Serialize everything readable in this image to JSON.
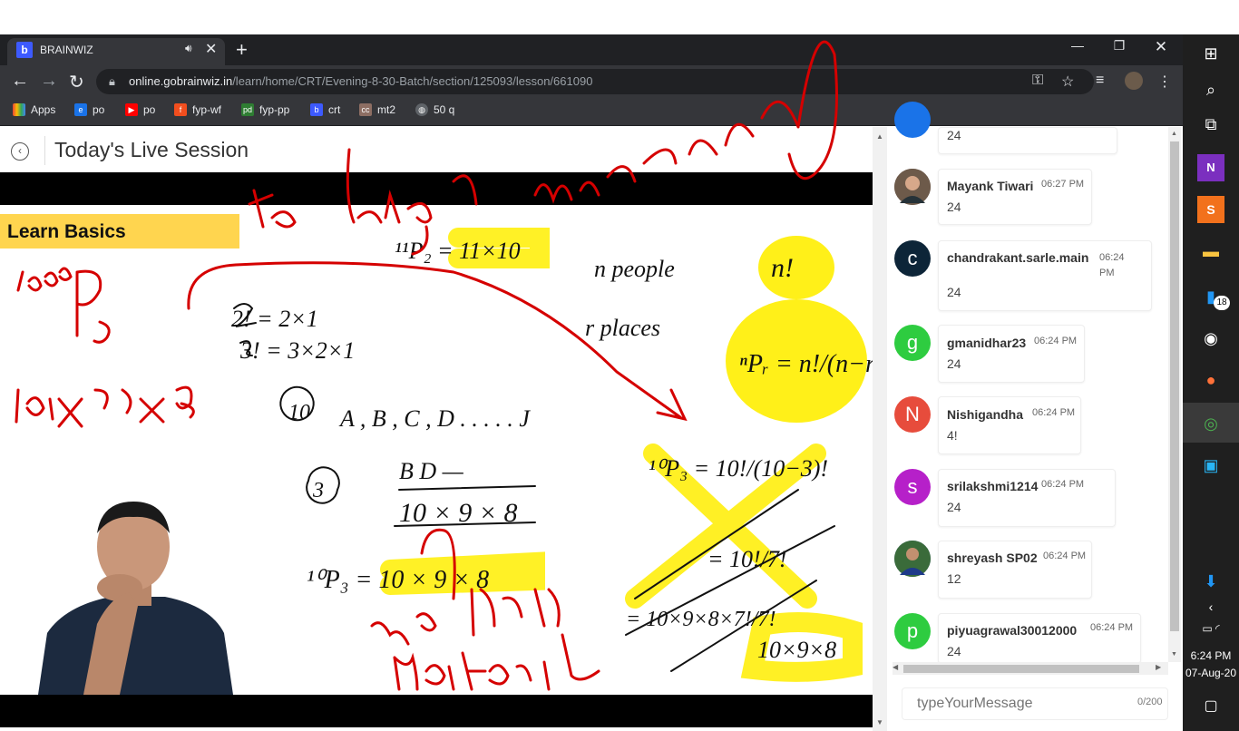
{
  "browser": {
    "tab_title": "BRAINWIZ",
    "favicon": "b",
    "tab_audio_icon": "speaker-icon",
    "url_host": "online.gobrainwiz.in",
    "url_path": "/learn/home/CRT/Evening-8-30-Batch/section/125093/lesson/661090",
    "bookmarks": [
      {
        "label": "Apps",
        "icon": "apps-grid-icon",
        "color": "#ea4335"
      },
      {
        "label": "po",
        "icon": "edge-icon",
        "color": "#1a73e8"
      },
      {
        "label": "po",
        "icon": "youtube-icon",
        "color": "#ff0000"
      },
      {
        "label": "fyp-wf",
        "icon": "figma-icon",
        "color": "#f24e1e"
      },
      {
        "label": "fyp-pp",
        "icon": "pd-icon",
        "color": "#2e7d32"
      },
      {
        "label": "crt",
        "icon": "brainwiz-icon",
        "color": "#3d5afe"
      },
      {
        "label": "mt2",
        "icon": "cc-icon",
        "color": "#8d6e63"
      },
      {
        "label": "50 q",
        "icon": "globe-icon",
        "color": "#5f6368"
      }
    ]
  },
  "page": {
    "back_icon": "back-arrow-icon",
    "title": "Today's Live Session"
  },
  "video": {
    "slide_heading": "Learn Basics"
  },
  "chat": {
    "top_partial_text": "24",
    "messages": [
      {
        "name": "Mayank Tiwari",
        "time": "06:27 PM",
        "text": "24",
        "avatar": "photo",
        "color": "#5d4037"
      },
      {
        "name": "chandrakant.sarle.main",
        "time": "06:24 PM",
        "text": "24",
        "avatar": "c",
        "color": "#0d2538"
      },
      {
        "name": "gmanidhar23",
        "time": "06:24 PM",
        "text": "24",
        "avatar": "g",
        "color": "#2ecc40"
      },
      {
        "name": "Nishigandha",
        "time": "06:24 PM",
        "text": "4!",
        "avatar": "N",
        "color": "#e74c3c"
      },
      {
        "name": "srilakshmi1214",
        "time": "06:24 PM",
        "text": "24",
        "avatar": "s",
        "color": "#b620c9"
      },
      {
        "name": "shreyash SP02",
        "time": "06:24 PM",
        "text": "12",
        "avatar": "photo",
        "color": "#2a5a8a"
      },
      {
        "name": "piyuagrawal30012000",
        "time": "06:24 PM",
        "text": "24",
        "avatar": "p",
        "color": "#2ecc40"
      }
    ],
    "compose_placeholder": "typeYourMessage",
    "counter": "0/200"
  },
  "taskbar": {
    "time": "6:24 PM",
    "date": "07-Aug-20",
    "badge_count": "18",
    "icons": [
      "windows-start-icon",
      "search-icon",
      "task-view-icon",
      "onenote-icon",
      "sublime-icon",
      "file-explorer-icon",
      "phone-icon",
      "obs-icon",
      "firefox-icon",
      "chrome-icon",
      "photos-icon"
    ]
  }
}
